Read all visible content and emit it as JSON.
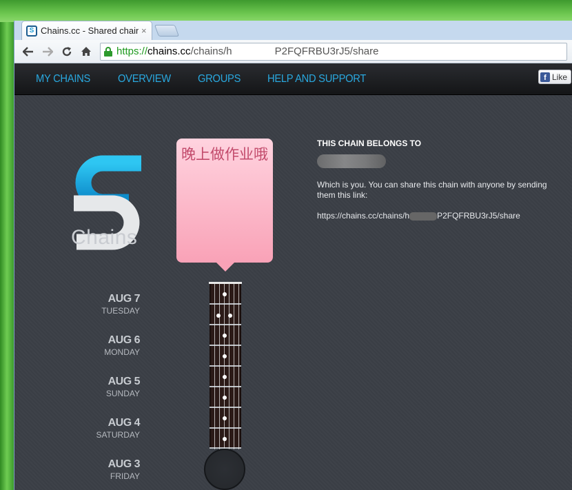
{
  "browser": {
    "tab_title": "Chains.cc - Shared chain",
    "tab_close": "×",
    "favicon": "S",
    "url_scheme": "https://",
    "url_host": "chains.cc",
    "url_path_start": "/chains/h",
    "url_path_end": "P2FQFRBU3rJ5/share",
    "icons": [
      "back-arrow-icon",
      "forward-arrow-icon",
      "reload-icon",
      "home-icon",
      "lock-icon"
    ]
  },
  "nav": {
    "items": [
      {
        "label": "MY CHAINS"
      },
      {
        "label": "OVERVIEW"
      },
      {
        "label": "GROUPS"
      },
      {
        "label": "HELP AND SUPPORT"
      }
    ],
    "fb_like": "Like"
  },
  "logo": {
    "text": "Chains"
  },
  "bubble": {
    "text": "晚上做作业哦"
  },
  "dates": [
    {
      "date": "AUG 7",
      "weekday": "TUESDAY"
    },
    {
      "date": "AUG 6",
      "weekday": "MONDAY"
    },
    {
      "date": "AUG 5",
      "weekday": "SUNDAY"
    },
    {
      "date": "AUG 4",
      "weekday": "SATURDAY"
    },
    {
      "date": "AUG 3",
      "weekday": "FRIDAY"
    }
  ],
  "info": {
    "heading": "THIS CHAIN BELONGS TO",
    "description": "Which is you. You can share this chain with anyone by sending them this link:",
    "link_start": "https://chains.cc/chains/h",
    "link_end": "P2FQFRBU3rJ5/share"
  },
  "colors": {
    "nav_link": "#29a8df",
    "page_bg": "#3b3f46",
    "bubble": "#f9a2b7",
    "url_secure": "#1e9a1e"
  }
}
